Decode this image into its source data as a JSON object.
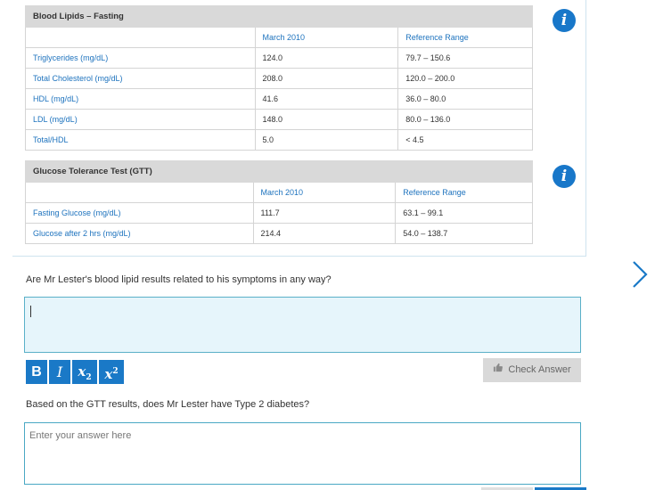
{
  "lipids": {
    "title": "Blood Lipids – Fasting",
    "col_date": "March 2010",
    "col_ref": "Reference Range",
    "rows": [
      {
        "name": "Triglycerides (mg/dL)",
        "value": "124.0",
        "ref": "79.7 – 150.6"
      },
      {
        "name": "Total Cholesterol (mg/dL)",
        "value": "208.0",
        "ref": "120.0 – 200.0"
      },
      {
        "name": "HDL (mg/dL)",
        "value": "41.6",
        "ref": "36.0 – 80.0"
      },
      {
        "name": "LDL (mg/dL)",
        "value": "148.0",
        "ref": "80.0 – 136.0"
      },
      {
        "name": "Total/HDL",
        "value": "5.0",
        "ref": "< 4.5"
      }
    ]
  },
  "gtt": {
    "title": "Glucose Tolerance Test (GTT)",
    "col_date": "March 2010",
    "col_ref": "Reference Range",
    "rows": [
      {
        "name": "Fasting Glucose (mg/dL)",
        "value": "111.7",
        "ref": "63.1 – 99.1"
      },
      {
        "name": "Glucose after 2 hrs (mg/dL)",
        "value": "214.4",
        "ref": "54.0 – 138.7"
      }
    ]
  },
  "info_icon": {
    "glyph": "i"
  },
  "question1": {
    "text": "Are Mr Lester's blood lipid results related to his symptoms in any way?",
    "value": ""
  },
  "question2": {
    "text": "Based on the GTT results, does Mr Lester have Type 2 diabetes?",
    "placeholder": "Enter your answer here"
  },
  "toolbar": {
    "bold": "B",
    "italic": "I",
    "sub_base": "x",
    "sub": "2",
    "sup_base": "x",
    "sup": "2"
  },
  "check_answer": {
    "label": "Check Answer",
    "icon": "thumbs-up-icon"
  },
  "colors": {
    "accent": "#1a79c7",
    "header_gray": "#d9d9d9",
    "answer_bg": "#e6f5fb"
  }
}
